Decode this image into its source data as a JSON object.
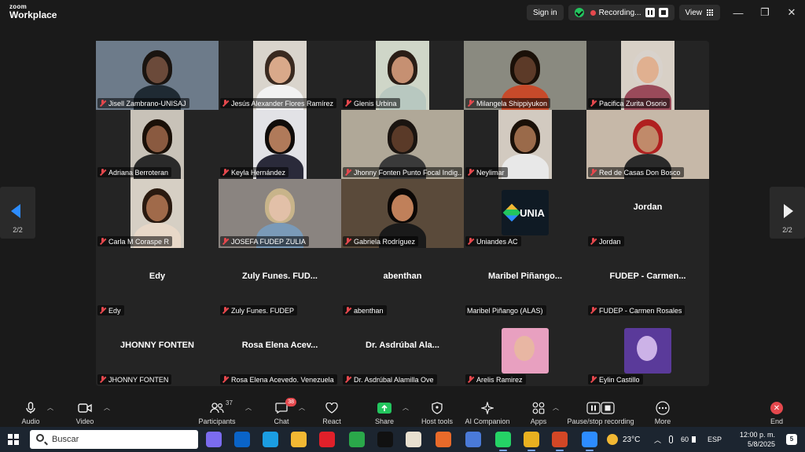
{
  "app": {
    "logo_small": "zoom",
    "logo_big": "Workplace"
  },
  "titlebar": {
    "sign_in": "Sign in",
    "recording": "Recording...",
    "view": "View",
    "minimize_glyph": "—",
    "restore_glyph": "❐",
    "close_glyph": "✕"
  },
  "gallery": {
    "page": "2/2",
    "tiles": [
      {
        "label": "Jisell Zambrano-UNISAJ",
        "type": "video",
        "bg": "#6d7b8a",
        "skin": "#6b4a3a",
        "cloth": "#1f2a33",
        "hair": "#1a1410"
      },
      {
        "label": "Jesús Alexander Flores Ramírez",
        "type": "video",
        "bg": "#d9d4cc",
        "skin": "#d9a98a",
        "cloth": "#f2f2f2",
        "hair": "#3a2a20"
      },
      {
        "label": "Glenis Urbina",
        "type": "video",
        "bg": "#cfd6c8",
        "skin": "#c69072",
        "cloth": "#b8c8c0",
        "hair": "#2a1d16"
      },
      {
        "label": "Milangela Shippiyukon",
        "type": "video",
        "bg": "#8a8a80",
        "skin": "#5c3a28",
        "cloth": "#c74a2a",
        "hair": "#1a1008"
      },
      {
        "label": "Pacifica Zurita Osorio",
        "type": "video",
        "bg": "#d8d0c6",
        "skin": "#e0b090",
        "cloth": "#9a4a5a",
        "hair": "#d8d2cc"
      },
      {
        "label": "Adriana Berroteran",
        "type": "video",
        "bg": "#c8c2b8",
        "skin": "#8a5a40",
        "cloth": "#2a2a2a",
        "hair": "#1a1008"
      },
      {
        "label": "Keyla Hernández",
        "type": "video",
        "bg": "#e2e2e6",
        "skin": "#b07a5a",
        "cloth": "#2a2a3a",
        "hair": "#100c0a"
      },
      {
        "label": "Jhonny Fonten Punto Focal Indig...",
        "type": "video",
        "active": true,
        "bg": "#b0a898",
        "skin": "#5a3a28",
        "cloth": "#3a3a3a",
        "hair": "#1a1410"
      },
      {
        "label": "Neylimar",
        "type": "video",
        "bg": "#d2cac0",
        "skin": "#9a6a4a",
        "cloth": "#e8e8e8",
        "hair": "#1a1008"
      },
      {
        "label": "Red de Casas Don Bosco",
        "type": "video",
        "bg": "#c6b8a8",
        "skin": "#c08a6a",
        "cloth": "#2a2a2a",
        "hair": "#b02020"
      },
      {
        "label": "Carla M Coraspe R",
        "type": "video",
        "bg": "#d6cfc4",
        "skin": "#a06a4a",
        "cloth": "#e8d8c8",
        "hair": "#2a1a10"
      },
      {
        "label": "JOSEFA FUDEP ZULIA",
        "type": "video",
        "bg": "#8a8480",
        "skin": "#e2c0a8",
        "cloth": "#7a9ab8",
        "hair": "#c8b48a"
      },
      {
        "label": "Gabriela Rodríguez",
        "type": "video",
        "bg": "#5a4a3a",
        "skin": "#c0805a",
        "cloth": "#1a1a1a",
        "hair": "#0c0806"
      },
      {
        "label": "Uniandes AC",
        "type": "logo",
        "logo_text": "UNIA"
      },
      {
        "label": "Jordan",
        "type": "name",
        "display": "Jordan"
      },
      {
        "label": "Edy",
        "type": "name",
        "display": "Edy"
      },
      {
        "label": "Zuly Funes. FUDEP",
        "type": "name",
        "display": "Zuly Funes. FUD..."
      },
      {
        "label": "abenthan",
        "type": "name",
        "display": "abenthan"
      },
      {
        "label": "Maribel Piñango (ALAS)",
        "type": "name",
        "display": "Maribel Piñango...",
        "no_mic_icon": true
      },
      {
        "label": "FUDEP - Carmen Rosales",
        "type": "name",
        "display": "FUDEP - Carmen..."
      },
      {
        "label": "JHONNY FONTEN",
        "type": "name",
        "display": "JHONNY FONTEN"
      },
      {
        "label": "Rosa Elena Acevedo. Venezuela",
        "type": "name",
        "display": "Rosa Elena Acev..."
      },
      {
        "label": "Dr. Asdrúbal Alamilla Ove",
        "type": "name",
        "display": "Dr. Asdrúbal Ala..."
      },
      {
        "label": "Arelis Ramirez",
        "type": "avatar",
        "bg": "#e8a0c0"
      },
      {
        "label": "Eylin Castillo",
        "type": "avatar",
        "bg": "#5a3a9a"
      }
    ]
  },
  "toolbar": {
    "audio": "Audio",
    "video": "Video",
    "participants": "Participants",
    "participants_count": "37",
    "chat": "Chat",
    "chat_badge": "38",
    "react": "React",
    "share": "Share",
    "host_tools": "Host tools",
    "ai_companion": "AI Companion",
    "apps": "Apps",
    "pause_stop": "Pause/stop recording",
    "more": "More",
    "end": "End"
  },
  "taskbar": {
    "search_placeholder": "Buscar",
    "temperature": "23°C",
    "volume": "60",
    "language": "ESP",
    "time": "12:00 p. m.",
    "date": "5/8/2025",
    "notifications": "5",
    "apps": [
      {
        "name": "copilot",
        "color": "#7b6cf0"
      },
      {
        "name": "outlook",
        "color": "#0a64c8"
      },
      {
        "name": "edge",
        "color": "#1b9de2"
      },
      {
        "name": "file-explorer",
        "color": "#f2b833"
      },
      {
        "name": "opera",
        "color": "#e0202a"
      },
      {
        "name": "maps",
        "color": "#2aa84a"
      },
      {
        "name": "tiktok",
        "color": "#111111"
      },
      {
        "name": "paint",
        "color": "#e8e0d0"
      },
      {
        "name": "unknown-app",
        "color": "#e86a2a"
      },
      {
        "name": "photos",
        "color": "#4a7ad8"
      },
      {
        "name": "whatsapp",
        "color": "#25d366"
      },
      {
        "name": "chrome",
        "color": "#e8b020"
      },
      {
        "name": "powerpoint",
        "color": "#d24726"
      },
      {
        "name": "zoom",
        "color": "#2d8cff"
      }
    ]
  }
}
